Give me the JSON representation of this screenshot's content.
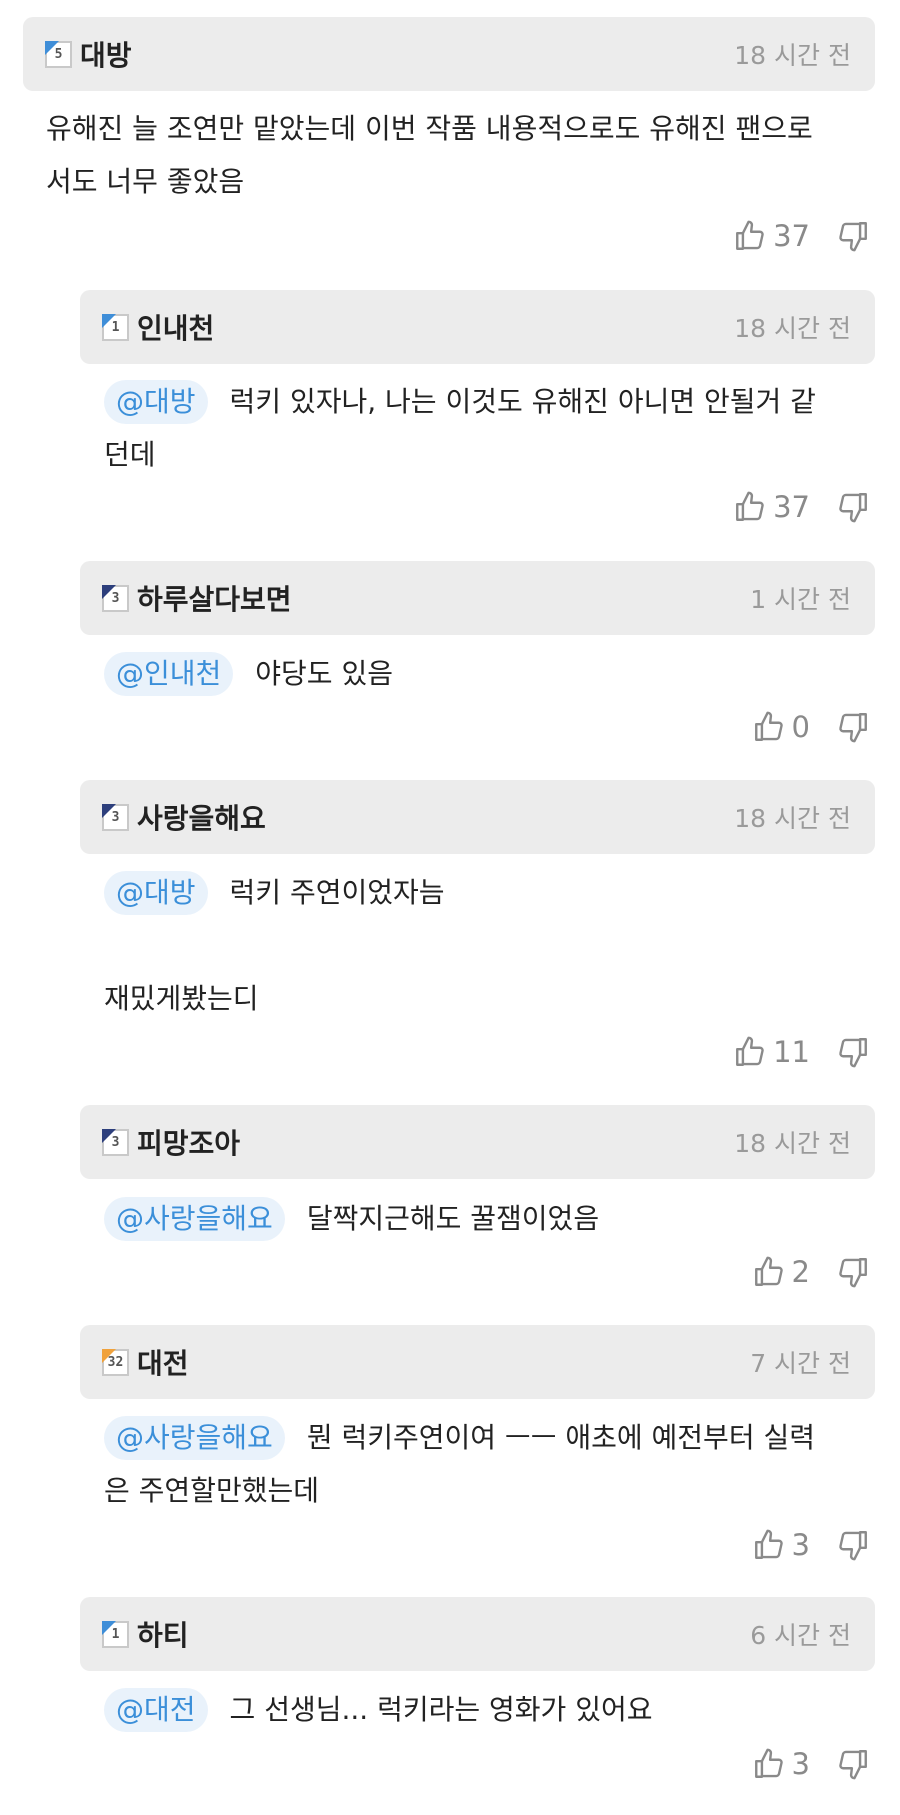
{
  "colors": {
    "level_blue": "#3f8ed8",
    "level_navy": "#2d3f7c",
    "level_orange": "#f0a23c",
    "mention": "#3b8fd9"
  },
  "comments": [
    {
      "user": "대방",
      "level": "5",
      "level_color": "#3f8ed8",
      "time": "18 시간 전",
      "mention": "",
      "lines": [
        "유해진 늘 조연만 맡았는데 이번 작품 내용적으로도 유해진 팬으로",
        "서도 너무 좋았음"
      ],
      "upvotes": "37",
      "icons": [
        "thumbs-up-icon",
        "thumbs-down-icon"
      ]
    },
    {
      "user": "인내천",
      "level": "1",
      "level_color": "#3f8ed8",
      "time": "18 시간 전",
      "mention": "@대방",
      "lines": [
        "럭키 있자나, 나는 이것도 유해진 아니면 안될거 같",
        "던데"
      ],
      "upvotes": "37"
    },
    {
      "user": "하루살다보면",
      "level": "3",
      "level_color": "#2d3f7c",
      "time": "1 시간 전",
      "mention": "@인내천",
      "lines": [
        "야당도 있음"
      ],
      "upvotes": "0"
    },
    {
      "user": "사랑을해요",
      "level": "3",
      "level_color": "#2d3f7c",
      "time": "18 시간 전",
      "mention": "@대방",
      "lines": [
        "럭키 주연이었자늠",
        "",
        "재밌게봤는디"
      ],
      "upvotes": "11"
    },
    {
      "user": "피망조아",
      "level": "3",
      "level_color": "#2d3f7c",
      "time": "18 시간 전",
      "mention": "@사랑을해요",
      "lines": [
        "달짝지근해도 꿀잼이었음"
      ],
      "upvotes": "2"
    },
    {
      "user": "대전",
      "level": "32",
      "level_color": "#f0a23c",
      "time": "7 시간 전",
      "mention": "@사랑을해요",
      "lines": [
        "뭔 럭키주연이여 ㅡㅡ 애초에 예전부터 실력",
        "은 주연할만했는데"
      ],
      "upvotes": "3"
    },
    {
      "user": "하티",
      "level": "1",
      "level_color": "#3f8ed8",
      "time": "6 시간 전",
      "mention": "@대전",
      "lines": [
        "그 선생님... 럭키라는 영화가 있어요"
      ],
      "upvotes": "3"
    }
  ]
}
